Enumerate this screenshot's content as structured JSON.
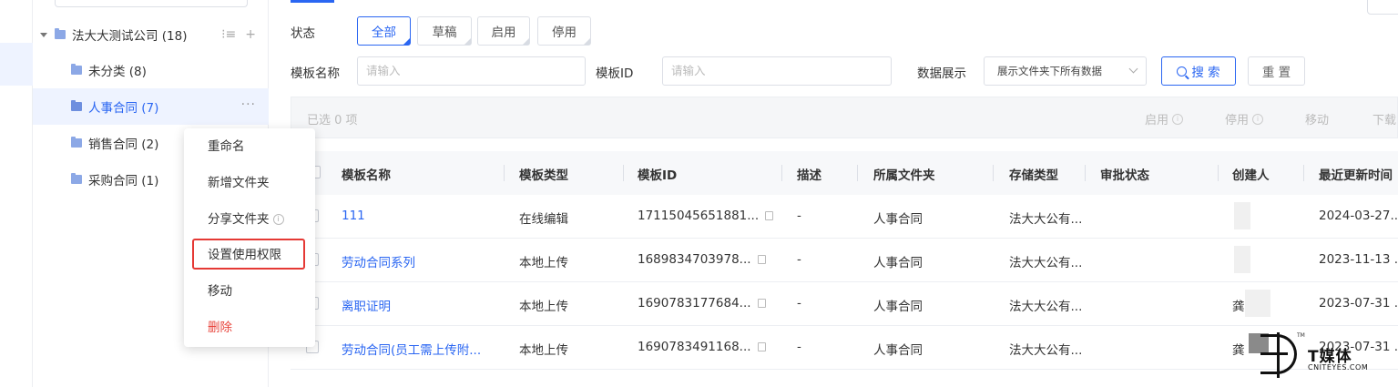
{
  "tree": {
    "root": {
      "label": "法大大测试公司 (18)"
    },
    "items": [
      {
        "label": "未分类 (8)"
      },
      {
        "label": "人事合同 (7)"
      },
      {
        "label": "销售合同 (2)"
      },
      {
        "label": "采购合同 (1)"
      }
    ],
    "tool_icons": [
      "sort-icon",
      "plus-icon"
    ],
    "more_icon": "more-icon"
  },
  "context_menu": {
    "items": [
      {
        "label": "重命名"
      },
      {
        "label": "新增文件夹"
      },
      {
        "label": "分享文件夹"
      },
      {
        "label": "设置使用权限"
      },
      {
        "label": "移动"
      },
      {
        "label": "删除"
      }
    ],
    "highlight_color": "#e53935",
    "danger_color": "#e8453c"
  },
  "filters": {
    "status_label": "状态",
    "status_options": [
      "全部",
      "草稿",
      "启用",
      "停用"
    ],
    "status_selected": "全部",
    "name_label": "模板名称",
    "name_placeholder": "请输入",
    "id_label": "模板ID",
    "id_placeholder": "请输入",
    "display_label": "数据展示",
    "display_value": "展示文件夹下所有数据",
    "search_button": "搜 索",
    "reset_button": "重 置"
  },
  "batch_bar": {
    "selected_text": "已选  0  项",
    "actions": [
      "启用",
      "停用",
      "移动",
      "下载"
    ]
  },
  "table": {
    "columns": [
      "模板名称",
      "模板类型",
      "模板ID",
      "描述",
      "所属文件夹",
      "存储类型",
      "审批状态",
      "创建人",
      "最近更新时间"
    ],
    "rows": [
      {
        "name": "111",
        "type": "在线编辑",
        "id": "17115045651881...",
        "desc": "-",
        "folder": "人事合同",
        "storage": "法大大公有...",
        "approval": "",
        "creator": "",
        "updated": "2024-03-27..."
      },
      {
        "name": "劳动合同系列",
        "type": "本地上传",
        "id": "1689834703978...",
        "desc": "-",
        "folder": "人事合同",
        "storage": "法大大公有...",
        "approval": "",
        "creator": "",
        "updated": "2023-11-13 ..."
      },
      {
        "name": "离职证明",
        "type": "本地上传",
        "id": "1690783177684...",
        "desc": "-",
        "folder": "人事合同",
        "storage": "法大大公有...",
        "approval": "",
        "creator": "龚",
        "updated": "2023-07-31 ..."
      },
      {
        "name": "劳动合同(员工需上传附...",
        "type": "本地上传",
        "id": "1690783491168...",
        "desc": "-",
        "folder": "人事合同",
        "storage": "法大大公有...",
        "approval": "",
        "creator": "龚",
        "updated": "2023-07-31 ..."
      }
    ]
  },
  "colors": {
    "accent": "#2a66f2",
    "active_bg": "#eef3ff"
  },
  "watermark": {
    "title": "T媒体",
    "subtitle": "CNITEYES.COM",
    "tm": "TM"
  }
}
